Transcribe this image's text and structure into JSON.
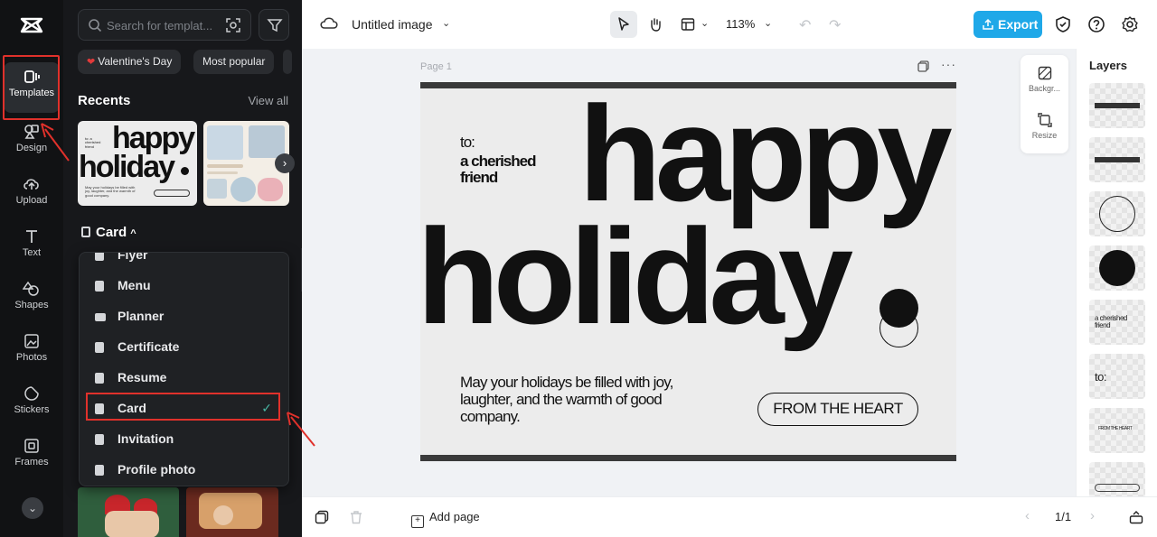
{
  "rail": {
    "items": [
      {
        "label": "Templates",
        "icon": "templates-icon",
        "active": true
      },
      {
        "label": "Design",
        "icon": "design-icon"
      },
      {
        "label": "Upload",
        "icon": "upload-icon"
      },
      {
        "label": "Text",
        "icon": "text-icon"
      },
      {
        "label": "Shapes",
        "icon": "shapes-icon"
      },
      {
        "label": "Photos",
        "icon": "photos-icon"
      },
      {
        "label": "Stickers",
        "icon": "stickers-icon"
      },
      {
        "label": "Frames",
        "icon": "frames-icon"
      }
    ]
  },
  "panel": {
    "search_placeholder": "Search for templat...",
    "chips": [
      {
        "label": "Valentine's Day",
        "icon": "heart-icon"
      },
      {
        "label": "Most popular"
      }
    ],
    "recents_title": "Recents",
    "view_all": "View all",
    "recent_thumb": {
      "happy": "happy",
      "holiday": "holiday",
      "small": "to: a cherished friend",
      "msg": "May your holidays be filled with joy, laughter, and the warmth of good company."
    },
    "section_title": "Card",
    "dropdown": [
      {
        "label": "Flyer"
      },
      {
        "label": "Menu"
      },
      {
        "label": "Planner"
      },
      {
        "label": "Certificate"
      },
      {
        "label": "Resume"
      },
      {
        "label": "Card",
        "selected": true
      },
      {
        "label": "Invitation"
      },
      {
        "label": "Profile photo"
      }
    ]
  },
  "topbar": {
    "doc_title": "Untitled image",
    "zoom": "113%",
    "export_label": "Export"
  },
  "canvas": {
    "page_label": "Page 1",
    "card": {
      "to": "to:",
      "recipient": "a cherished friend",
      "happy": "happy",
      "holiday": "holiday",
      "message": "May your holidays be filled with joy, laughter, and the warmth of good company.",
      "pill": "FROM THE HEART"
    },
    "side_tools": [
      {
        "label": "Backgr...",
        "icon": "background-icon"
      },
      {
        "label": "Resize",
        "icon": "resize-icon"
      }
    ]
  },
  "layers": {
    "title": "Layers",
    "layer_texts": {
      "recipient": "a cherished friend",
      "to": "to:",
      "pill": "FROM THE HEART"
    }
  },
  "bottombar": {
    "add_page": "Add page",
    "pager": "1/1"
  },
  "colors": {
    "accent_export": "#1fa8e8",
    "highlight_red": "#e0312b",
    "check_teal": "#49b8a5",
    "panel_bg": "#17181b"
  }
}
